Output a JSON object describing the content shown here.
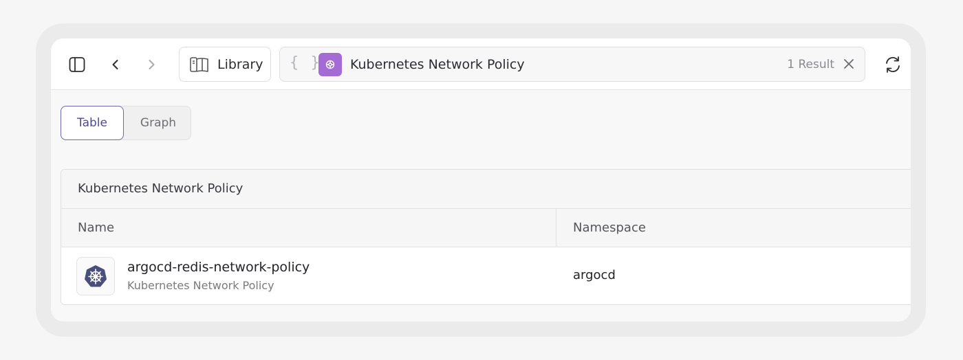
{
  "toolbar": {
    "library_label": "Library",
    "search": {
      "braces": "{ }",
      "title": "Kubernetes Network Policy",
      "result_count": "1 Result"
    }
  },
  "view_toggle": {
    "table_label": "Table",
    "graph_label": "Graph",
    "active": "Table"
  },
  "table": {
    "section_title": "Kubernetes Network Policy",
    "columns": [
      "Name",
      "Namespace"
    ],
    "rows": [
      {
        "name": "argocd-redis-network-policy",
        "type": "Kubernetes Network Policy",
        "namespace": "argocd",
        "icon": "kubernetes-helm-icon"
      }
    ]
  },
  "colors": {
    "accent": "#6a67b5",
    "chip": "#a46bd4",
    "k8s_icon": "#4a4e7a"
  }
}
